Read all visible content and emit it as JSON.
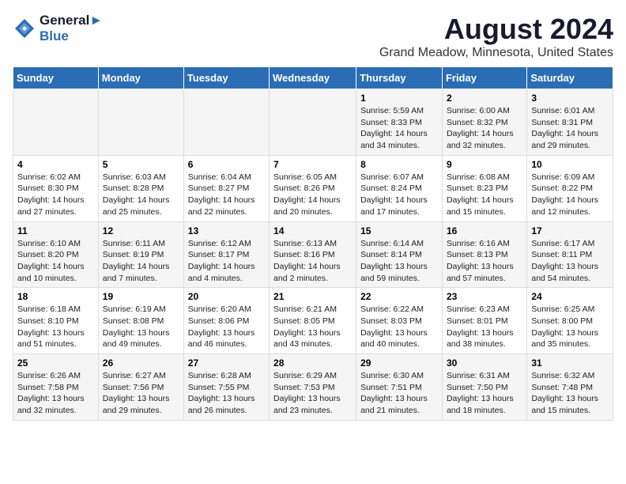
{
  "header": {
    "logo_line1": "General",
    "logo_line2": "Blue",
    "main_title": "August 2024",
    "subtitle": "Grand Meadow, Minnesota, United States"
  },
  "days_of_week": [
    "Sunday",
    "Monday",
    "Tuesday",
    "Wednesday",
    "Thursday",
    "Friday",
    "Saturday"
  ],
  "weeks": [
    [
      {
        "day": "",
        "info": ""
      },
      {
        "day": "",
        "info": ""
      },
      {
        "day": "",
        "info": ""
      },
      {
        "day": "",
        "info": ""
      },
      {
        "day": "1",
        "info": "Sunrise: 5:59 AM\nSunset: 8:33 PM\nDaylight: 14 hours\nand 34 minutes."
      },
      {
        "day": "2",
        "info": "Sunrise: 6:00 AM\nSunset: 8:32 PM\nDaylight: 14 hours\nand 32 minutes."
      },
      {
        "day": "3",
        "info": "Sunrise: 6:01 AM\nSunset: 8:31 PM\nDaylight: 14 hours\nand 29 minutes."
      }
    ],
    [
      {
        "day": "4",
        "info": "Sunrise: 6:02 AM\nSunset: 8:30 PM\nDaylight: 14 hours\nand 27 minutes."
      },
      {
        "day": "5",
        "info": "Sunrise: 6:03 AM\nSunset: 8:28 PM\nDaylight: 14 hours\nand 25 minutes."
      },
      {
        "day": "6",
        "info": "Sunrise: 6:04 AM\nSunset: 8:27 PM\nDaylight: 14 hours\nand 22 minutes."
      },
      {
        "day": "7",
        "info": "Sunrise: 6:05 AM\nSunset: 8:26 PM\nDaylight: 14 hours\nand 20 minutes."
      },
      {
        "day": "8",
        "info": "Sunrise: 6:07 AM\nSunset: 8:24 PM\nDaylight: 14 hours\nand 17 minutes."
      },
      {
        "day": "9",
        "info": "Sunrise: 6:08 AM\nSunset: 8:23 PM\nDaylight: 14 hours\nand 15 minutes."
      },
      {
        "day": "10",
        "info": "Sunrise: 6:09 AM\nSunset: 8:22 PM\nDaylight: 14 hours\nand 12 minutes."
      }
    ],
    [
      {
        "day": "11",
        "info": "Sunrise: 6:10 AM\nSunset: 8:20 PM\nDaylight: 14 hours\nand 10 minutes."
      },
      {
        "day": "12",
        "info": "Sunrise: 6:11 AM\nSunset: 8:19 PM\nDaylight: 14 hours\nand 7 minutes."
      },
      {
        "day": "13",
        "info": "Sunrise: 6:12 AM\nSunset: 8:17 PM\nDaylight: 14 hours\nand 4 minutes."
      },
      {
        "day": "14",
        "info": "Sunrise: 6:13 AM\nSunset: 8:16 PM\nDaylight: 14 hours\nand 2 minutes."
      },
      {
        "day": "15",
        "info": "Sunrise: 6:14 AM\nSunset: 8:14 PM\nDaylight: 13 hours\nand 59 minutes."
      },
      {
        "day": "16",
        "info": "Sunrise: 6:16 AM\nSunset: 8:13 PM\nDaylight: 13 hours\nand 57 minutes."
      },
      {
        "day": "17",
        "info": "Sunrise: 6:17 AM\nSunset: 8:11 PM\nDaylight: 13 hours\nand 54 minutes."
      }
    ],
    [
      {
        "day": "18",
        "info": "Sunrise: 6:18 AM\nSunset: 8:10 PM\nDaylight: 13 hours\nand 51 minutes."
      },
      {
        "day": "19",
        "info": "Sunrise: 6:19 AM\nSunset: 8:08 PM\nDaylight: 13 hours\nand 49 minutes."
      },
      {
        "day": "20",
        "info": "Sunrise: 6:20 AM\nSunset: 8:06 PM\nDaylight: 13 hours\nand 46 minutes."
      },
      {
        "day": "21",
        "info": "Sunrise: 6:21 AM\nSunset: 8:05 PM\nDaylight: 13 hours\nand 43 minutes."
      },
      {
        "day": "22",
        "info": "Sunrise: 6:22 AM\nSunset: 8:03 PM\nDaylight: 13 hours\nand 40 minutes."
      },
      {
        "day": "23",
        "info": "Sunrise: 6:23 AM\nSunset: 8:01 PM\nDaylight: 13 hours\nand 38 minutes."
      },
      {
        "day": "24",
        "info": "Sunrise: 6:25 AM\nSunset: 8:00 PM\nDaylight: 13 hours\nand 35 minutes."
      }
    ],
    [
      {
        "day": "25",
        "info": "Sunrise: 6:26 AM\nSunset: 7:58 PM\nDaylight: 13 hours\nand 32 minutes."
      },
      {
        "day": "26",
        "info": "Sunrise: 6:27 AM\nSunset: 7:56 PM\nDaylight: 13 hours\nand 29 minutes."
      },
      {
        "day": "27",
        "info": "Sunrise: 6:28 AM\nSunset: 7:55 PM\nDaylight: 13 hours\nand 26 minutes."
      },
      {
        "day": "28",
        "info": "Sunrise: 6:29 AM\nSunset: 7:53 PM\nDaylight: 13 hours\nand 23 minutes."
      },
      {
        "day": "29",
        "info": "Sunrise: 6:30 AM\nSunset: 7:51 PM\nDaylight: 13 hours\nand 21 minutes."
      },
      {
        "day": "30",
        "info": "Sunrise: 6:31 AM\nSunset: 7:50 PM\nDaylight: 13 hours\nand 18 minutes."
      },
      {
        "day": "31",
        "info": "Sunrise: 6:32 AM\nSunset: 7:48 PM\nDaylight: 13 hours\nand 15 minutes."
      }
    ]
  ]
}
